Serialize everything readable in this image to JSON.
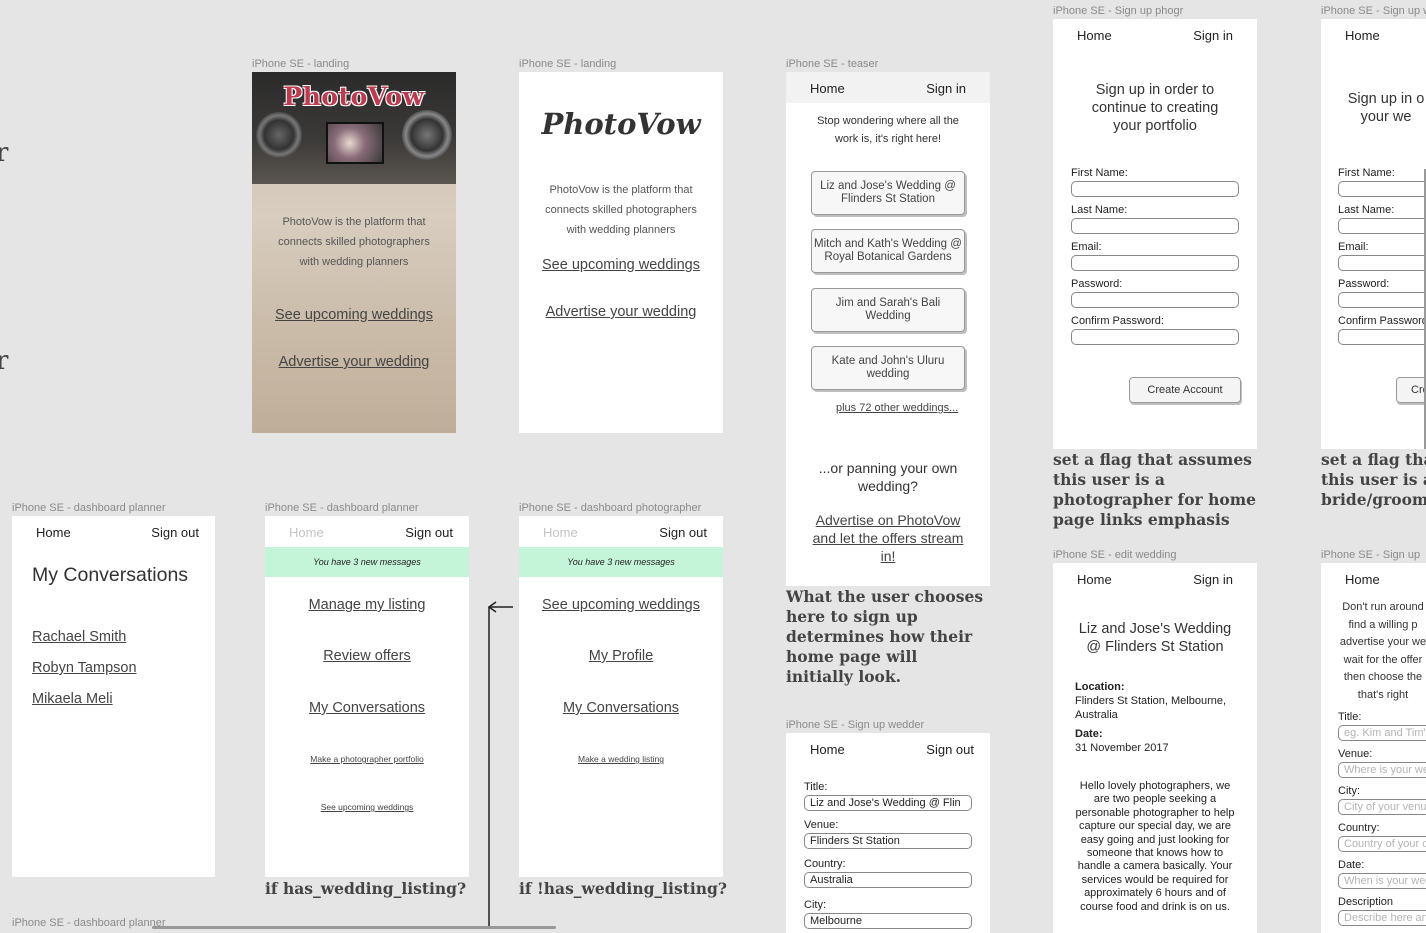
{
  "frame_labels": {
    "landing_img": "iPhone SE - landing",
    "landing_plain": "iPhone SE - landing",
    "teaser": "iPhone SE - teaser",
    "signup_photog": "iPhone SE - Sign up phogr",
    "signup_w": "iPhone SE - Sign up w",
    "dash_planner_a": "iPhone SE - dashboard planner",
    "dash_planner_b": "iPhone SE - dashboard planner",
    "dash_photog": "iPhone SE - dashboard photographer",
    "signup_wedder": "iPhone SE - Sign up wedder",
    "edit_wedding": "iPhone SE - edit wedding",
    "signup_up": "iPhone SE - Sign up",
    "dash_planner_bottom": "iPhone SE - dashboard planner"
  },
  "nav": {
    "home": "Home",
    "sign_in": "Sign in",
    "sign_out": "Sign out"
  },
  "landing": {
    "brand": "PhotoVow",
    "tagline": "PhotoVow is the platform that connects skilled photographers with wedding planners",
    "see_upcoming": "See upcoming weddings",
    "advertise": "Advertise your wedding"
  },
  "teaser": {
    "intro": "Stop wondering where all the work is, it's right here!",
    "weddings": [
      "Liz and Jose's Wedding @ Flinders St Station",
      "Mitch and Kath's Wedding @ Royal Botanical Gardens",
      "Jim and Sarah's Bali Wedding",
      "Kate and John's Uluru wedding"
    ],
    "more": "plus 72 other weddings...",
    "planning": "...or panning your own wedding?",
    "advertise_cta": "Advertise on PhotoVow and let the offers stream in!"
  },
  "signup_photog": {
    "heading": "Sign up in order to continue to creating your portfolio",
    "heading_cut": "Sign up in o your we",
    "labels": [
      "First Name:",
      "Last Name:",
      "Email:",
      "Password:",
      "Confirm Password:"
    ],
    "create": "Create Account",
    "create_cut": "Cre"
  },
  "notes": {
    "photog_flag": "set a flag that assumes this user is a photographer for home page links emphasis",
    "bride_flag": "set a flag that this user is a bride/groom",
    "teaser_choice": "What the user chooses here to sign up determines how their home page will initially look.",
    "has_listing": "if has_wedding_listing?",
    "no_listing": "if !has_wedding_listing?"
  },
  "dash_a": {
    "title": "My Conversations",
    "contacts": [
      "Rachael Smith",
      "Robyn Tampson",
      "Mikaela Meli"
    ]
  },
  "dash_b": {
    "banner": "You have 3 new messages",
    "links": [
      "Manage my listing",
      "Review offers",
      "My Conversations"
    ],
    "small_links": [
      "Make a photographer portfolio",
      "See upcoming weddings"
    ]
  },
  "dash_photog": {
    "banner": "You have 3 new messages",
    "links": [
      "See upcoming weddings",
      "My Profile",
      "My Conversations"
    ],
    "small_links": [
      "Make a wedding listing"
    ]
  },
  "signup_wedder": {
    "fields": [
      {
        "label": "Title:",
        "value": "Liz and Jose's Wedding @ Flin"
      },
      {
        "label": "Venue:",
        "value": "Flinders St Station"
      },
      {
        "label": "Country:",
        "value": "Australia"
      },
      {
        "label": "City:",
        "value": "Melbourne"
      }
    ]
  },
  "edit_wedding": {
    "title": "Liz and Jose's Wedding @ Flinders St Station",
    "location_label": "Location:",
    "location": "Flinders St Station, Melbourne, Australia",
    "date_label": "Date:",
    "date": "31 November 2017",
    "description": "Hello lovely photographers, we are two people seeking a personable photographer to help capture our special day, we are easy going and just looking for someone that knows how to handle a camera basically. Your services would be required for approximately 6 hours and of course food and drink is on us."
  },
  "signup_up": {
    "intro": "Don't run around find a willing p advertise your we wait for the offer then choose the that's right",
    "fields": [
      {
        "label": "Title:",
        "placeholder": "eg. Kim and Tim's"
      },
      {
        "label": "Venue:",
        "placeholder": "Where is your we"
      },
      {
        "label": "City:",
        "placeholder": "City of your venu"
      },
      {
        "label": "Country:",
        "placeholder": "Country of your c"
      },
      {
        "label": "Date:",
        "placeholder": "When is your wed"
      },
      {
        "label": "Description",
        "placeholder": "Describe here an"
      }
    ]
  },
  "stubs": [
    "r",
    "r"
  ]
}
